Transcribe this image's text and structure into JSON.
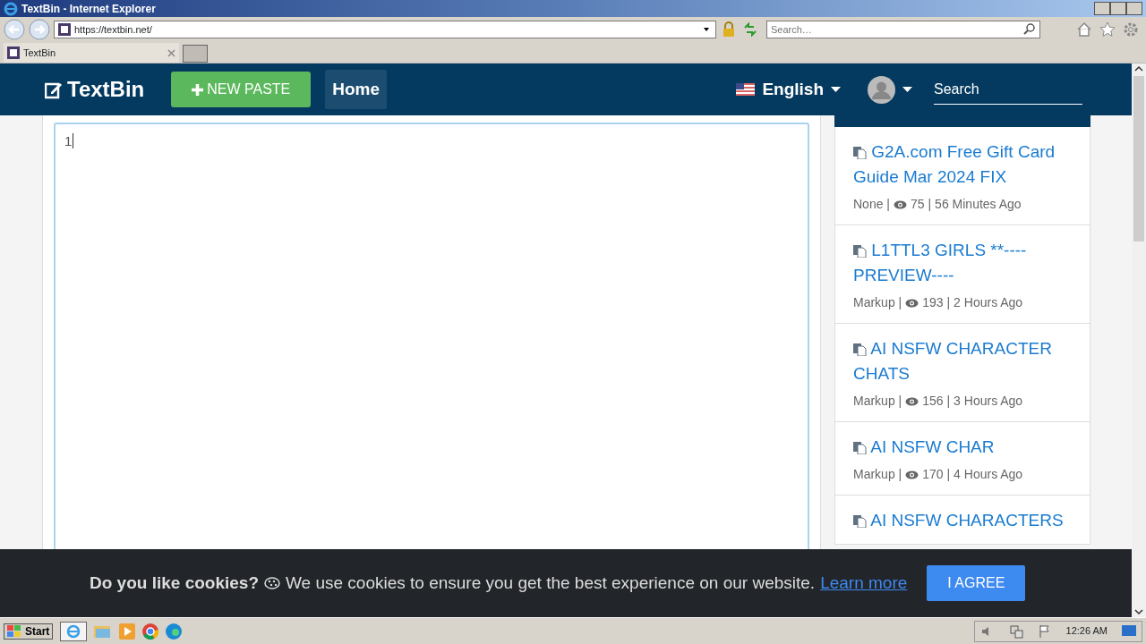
{
  "window": {
    "title": "TextBin - Internet Explorer"
  },
  "address_bar": {
    "url": "https://textbin.net/"
  },
  "browser_search": {
    "placeholder": "Search…"
  },
  "tabs": [
    {
      "label": "TextBin",
      "selected": true
    }
  ],
  "navbar": {
    "brand": "TextBin",
    "new_paste": "NEW PASTE",
    "home": "Home",
    "language": "English",
    "search": {
      "placeholder": "Search"
    }
  },
  "editor": {
    "line_number": "1"
  },
  "recent_pastes": [
    {
      "title": "G2A.com Free Gift Card Guide Mar 2024 FIX",
      "syntax": "None |",
      "views": "75 |",
      "age": "56 Minutes Ago"
    },
    {
      "title": "L1TTL3 GIRLS **---- PREVIEW----",
      "syntax": "Markup |",
      "views": "193 |",
      "age": "2 Hours Ago"
    },
    {
      "title": "AI NSFW CHARACTER CHATS",
      "syntax": "Markup |",
      "views": "156 |",
      "age": "3 Hours Ago"
    },
    {
      "title": "AI NSFW CHAR",
      "syntax": "Markup |",
      "views": "170 |",
      "age": "4 Hours Ago"
    },
    {
      "title": "AI NSFW CHARACTERS"
    }
  ],
  "cookie_banner": {
    "heading": "Do you like cookies?",
    "message": "We use cookies to ensure you get the best experience on our website.",
    "link": "Learn more",
    "button": "I AGREE"
  },
  "taskbar": {
    "start": "Start",
    "clock": "12:26 AM"
  }
}
